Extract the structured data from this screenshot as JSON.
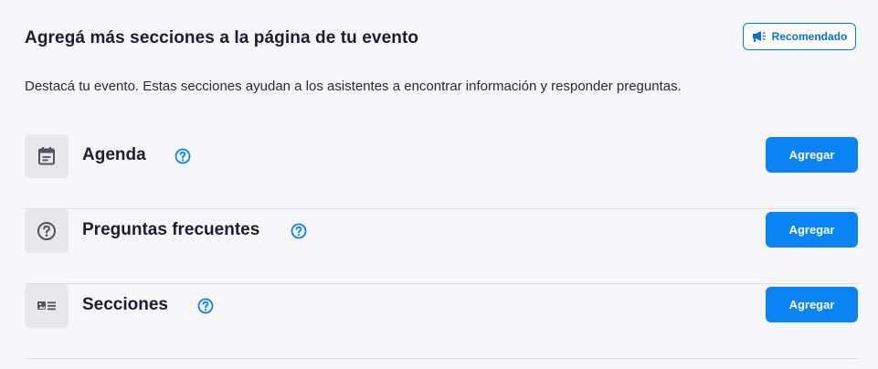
{
  "header": {
    "title": "Agregá más secciones a la página de tu evento",
    "badge_label": "Recomendado",
    "badge_icon": "megaphone-icon"
  },
  "subtitle": "Destacá tu evento. Estas secciones ayudan a los asistentes a encontrar información y responder preguntas.",
  "sections": [
    {
      "label": "Agenda",
      "icon": "calendar-icon",
      "help_icon": "help-circle-icon",
      "button_label": "Agregar"
    },
    {
      "label": "Preguntas frecuentes",
      "icon": "question-circle-icon",
      "help_icon": "help-circle-icon",
      "button_label": "Agregar"
    },
    {
      "label": "Secciones",
      "icon": "card-icon",
      "help_icon": "help-circle-icon",
      "button_label": "Agregar"
    }
  ],
  "colors": {
    "accent": "#0a84f5",
    "background": "#f7f6fb",
    "icon_box": "#e8e7ec",
    "text": "#1f1c2e"
  }
}
